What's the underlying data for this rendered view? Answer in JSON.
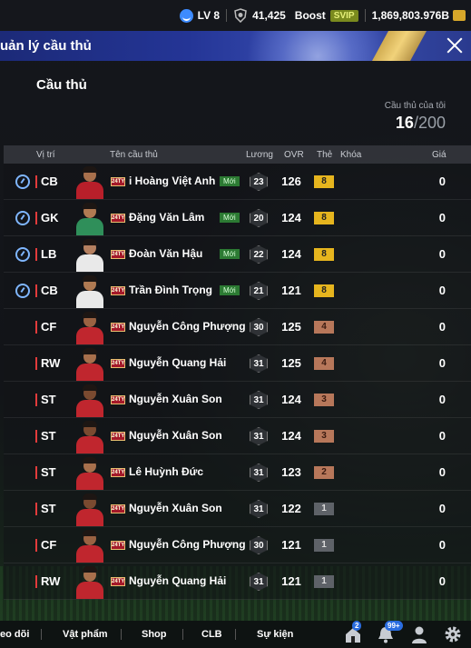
{
  "topbar": {
    "level": "LV 8",
    "points": "41,425",
    "boost_label": "Boost",
    "svip_label": "SVIP",
    "coins": "1,869,803.976B"
  },
  "banner": {
    "title": "uản lý cầu thủ"
  },
  "section": {
    "title": "Cầu thủ",
    "count_label": "Cầu thủ của tôi",
    "count_current": "16",
    "count_total": "/200"
  },
  "table": {
    "headers": {
      "position": "Vị trí",
      "name": "Tên cầu thủ",
      "salary": "Lương",
      "ovr": "OVR",
      "grade": "Thẻ",
      "lock": "Khóa",
      "price": "Giá"
    },
    "season_label": "24TY",
    "rows": [
      {
        "timer": true,
        "pos": "CB",
        "name": "i Hoàng Việt Anh",
        "new": "Mới",
        "salary": "23",
        "ovr": "126",
        "grade": "8",
        "price": "0",
        "jersey": "#b81f2a",
        "skin": "#a8704c"
      },
      {
        "timer": true,
        "pos": "GK",
        "name": "Đặng Văn Lâm",
        "new": "Mới",
        "salary": "20",
        "ovr": "124",
        "grade": "8",
        "price": "0",
        "jersey": "#2f8f5a",
        "skin": "#b07a52"
      },
      {
        "timer": true,
        "pos": "LB",
        "name": "Đoàn Văn Hậu",
        "new": "Mới",
        "salary": "22",
        "ovr": "124",
        "grade": "8",
        "price": "0",
        "jersey": "#e9e9e9",
        "skin": "#b58060"
      },
      {
        "timer": true,
        "pos": "CB",
        "name": "Trần Đình Trọng",
        "new": "Mới",
        "salary": "21",
        "ovr": "121",
        "grade": "8",
        "price": "0",
        "jersey": "#e9e9e9",
        "skin": "#b07a52"
      },
      {
        "timer": false,
        "pos": "CF",
        "name": "Nguyễn Công Phượng",
        "new": "",
        "salary": "30",
        "ovr": "125",
        "grade": "4",
        "price": "0",
        "jersey": "#c0262e",
        "skin": "#9a6242"
      },
      {
        "timer": false,
        "pos": "RW",
        "name": "Nguyễn Quang Hải",
        "new": "",
        "salary": "31",
        "ovr": "125",
        "grade": "4",
        "price": "0",
        "jersey": "#c0262e",
        "skin": "#a8704c"
      },
      {
        "timer": false,
        "pos": "ST",
        "name": "Nguyễn Xuân Son",
        "new": "",
        "salary": "31",
        "ovr": "124",
        "grade": "3",
        "price": "0",
        "jersey": "#c0262e",
        "skin": "#7a4a30"
      },
      {
        "timer": false,
        "pos": "ST",
        "name": "Nguyễn Xuân Son",
        "new": "",
        "salary": "31",
        "ovr": "124",
        "grade": "3",
        "price": "0",
        "jersey": "#c0262e",
        "skin": "#7a4a30"
      },
      {
        "timer": false,
        "pos": "ST",
        "name": "Lê Huỳnh Đức",
        "new": "",
        "salary": "31",
        "ovr": "123",
        "grade": "2",
        "price": "0",
        "jersey": "#c0262e",
        "skin": "#a8704c"
      },
      {
        "timer": false,
        "pos": "ST",
        "name": "Nguyễn Xuân Son",
        "new": "",
        "salary": "31",
        "ovr": "122",
        "grade": "1",
        "price": "0",
        "jersey": "#c0262e",
        "skin": "#7a4a30"
      },
      {
        "timer": false,
        "pos": "CF",
        "name": "Nguyễn Công Phượng",
        "new": "",
        "salary": "30",
        "ovr": "121",
        "grade": "1",
        "price": "0",
        "jersey": "#c0262e",
        "skin": "#9a6242"
      },
      {
        "timer": false,
        "pos": "RW",
        "name": "Nguyễn Quang Hải",
        "new": "",
        "salary": "31",
        "ovr": "121",
        "grade": "1",
        "price": "0",
        "jersey": "#c0262e",
        "skin": "#a8704c"
      }
    ]
  },
  "bottomnav": {
    "items": [
      "eo dõi",
      "Vật phẩm",
      "Shop",
      "CLB",
      "Sự kiện"
    ],
    "home_badge": "2",
    "notif_badge": "99+"
  }
}
